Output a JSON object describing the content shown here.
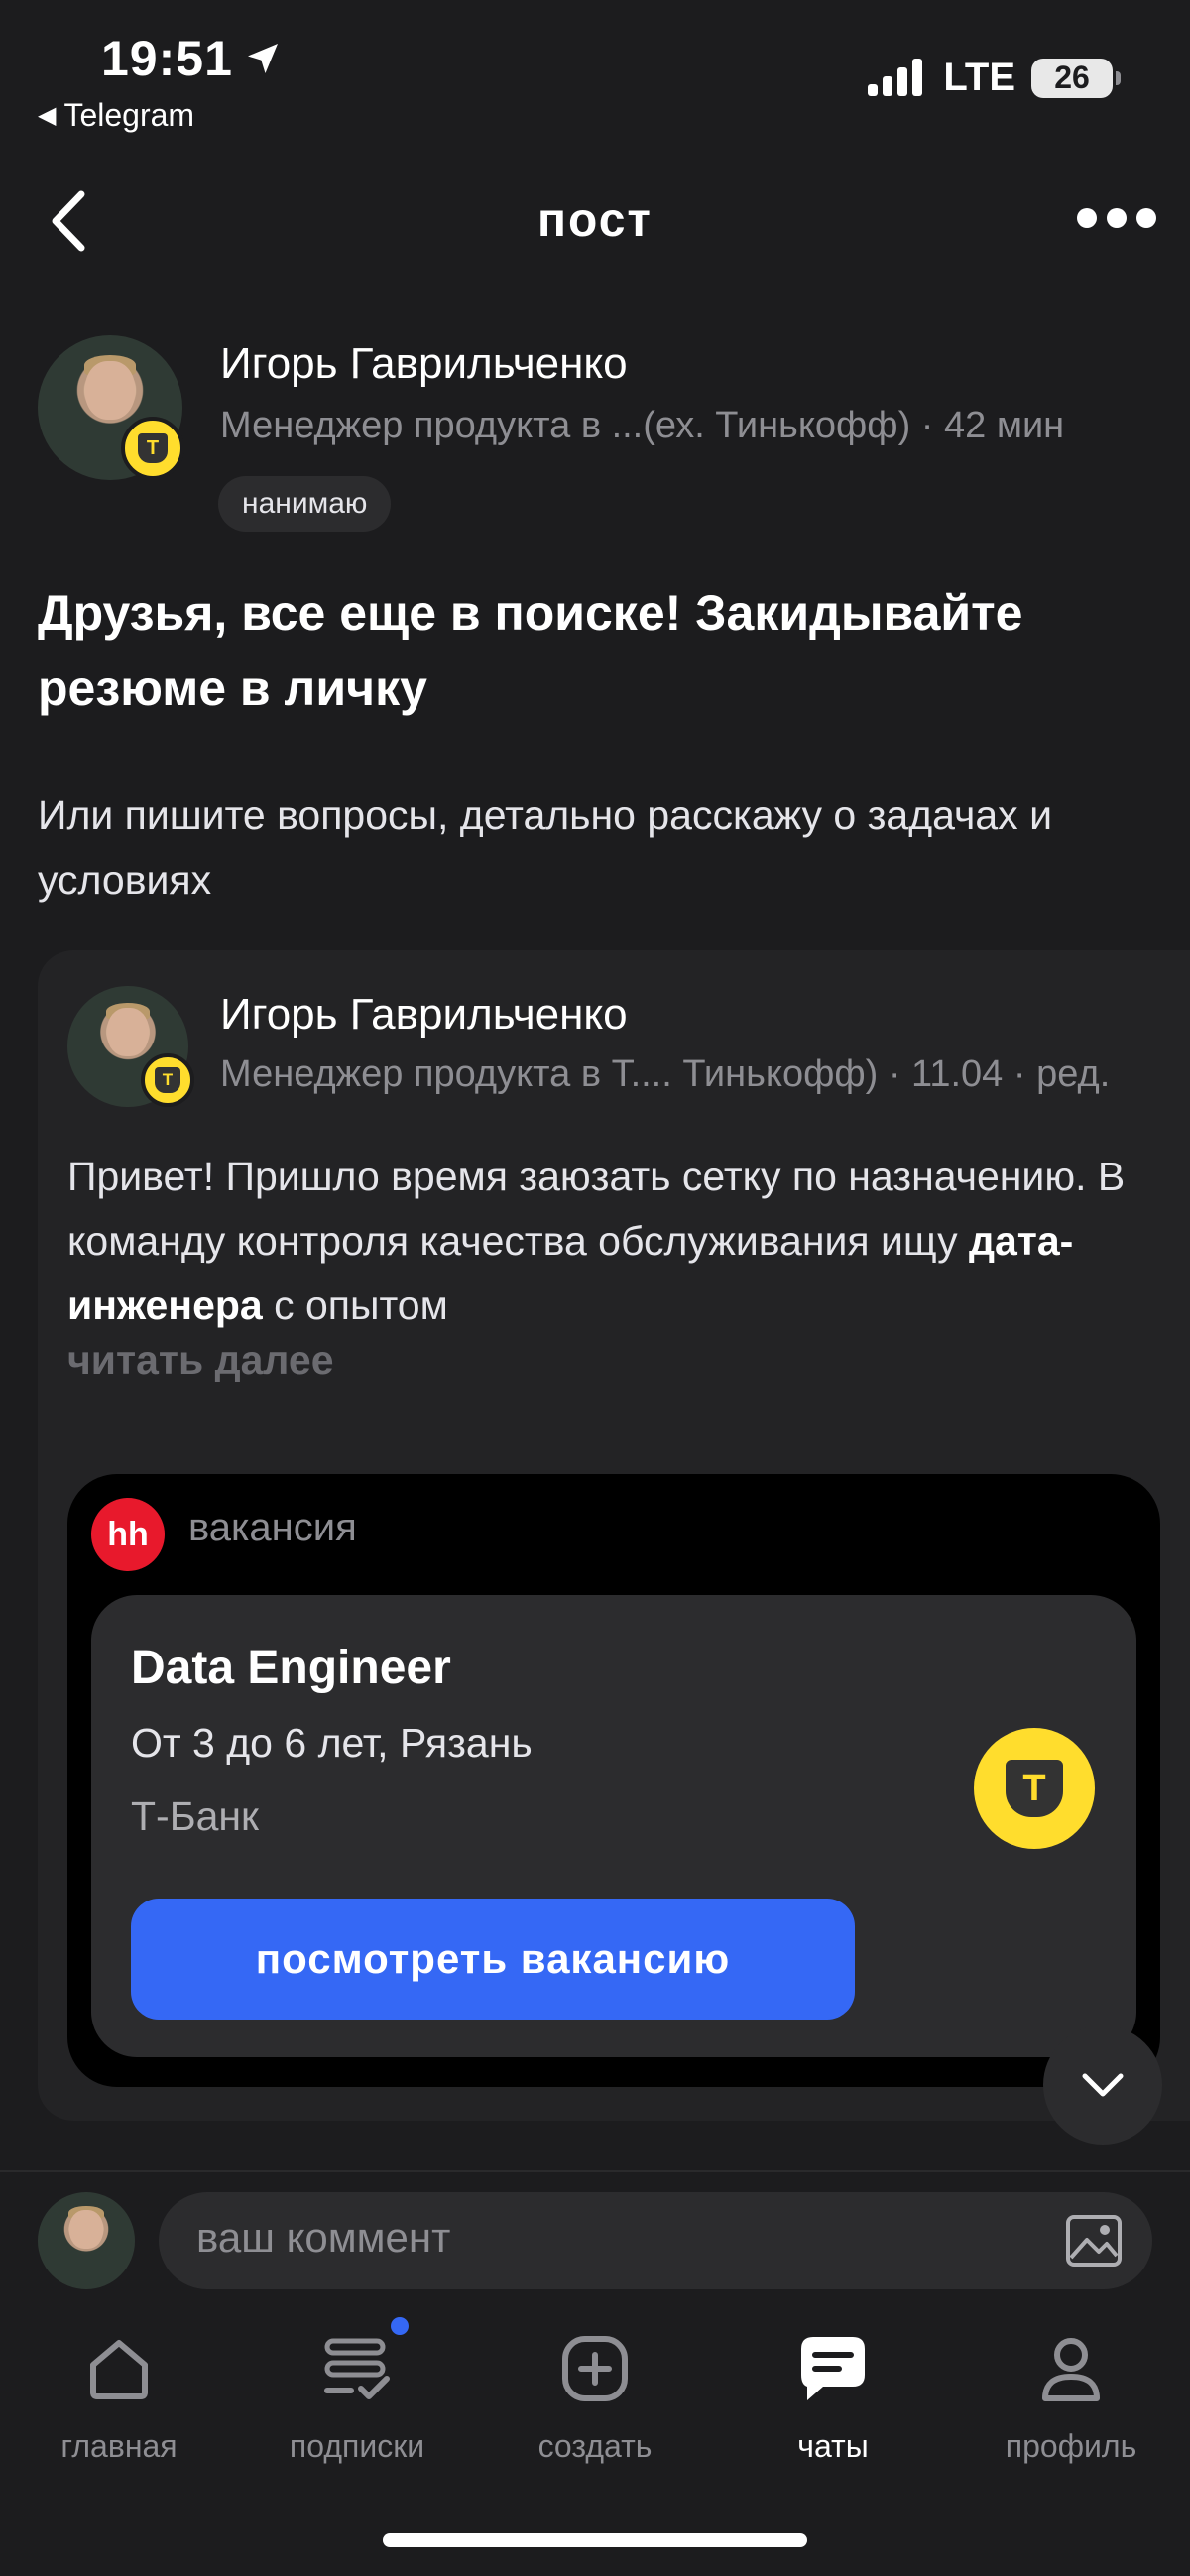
{
  "status_bar": {
    "time": "19:51",
    "back_app": "Telegram",
    "network": "LTE",
    "battery": "26"
  },
  "header": {
    "title": "пост"
  },
  "post": {
    "author_name": "Игорь Гаврильченко",
    "author_subtitle": "Менеджер продукта в ...(ех. Тинькофф) · 42 мин",
    "tag": "нанимаю",
    "title": "Друзья, все еще в поиске! Закидывайте резюме в личку",
    "body": "Или пишите вопросы, детально расскажу о задачах и условиях"
  },
  "repost": {
    "author_name": "Игорь Гаврильченко",
    "author_subtitle": "Менеджер продукта в Т.... Тинькофф) · 11.04 · ред.",
    "body_before": "Привет! Пришло время заюзать сетку по назначению. В команду контроля качества обслуживания ищу ",
    "body_bold": "дата-инженера",
    "body_after": " с опытом",
    "read_more": "читать далее",
    "vacancy": {
      "source_logo": "hh",
      "label": "вакансия",
      "title": "Data Engineer",
      "experience": "От 3 до 6 лет, Рязань",
      "company": "Т-Банк",
      "company_logo": "Т",
      "button": "посмотреть вакансию"
    }
  },
  "comment": {
    "placeholder": "ваш коммент"
  },
  "tabs": [
    {
      "label": "главная",
      "icon": "home-icon"
    },
    {
      "label": "подписки",
      "icon": "subscriptions-icon"
    },
    {
      "label": "создать",
      "icon": "plus-square-icon"
    },
    {
      "label": "чаты",
      "icon": "chat-icon",
      "active": true
    },
    {
      "label": "профиль",
      "icon": "profile-icon"
    }
  ],
  "colors": {
    "accent": "#3568f5",
    "tbank_yellow": "#ffdd2d",
    "hh_red": "#e8192c",
    "background": "#1c1c1e"
  }
}
